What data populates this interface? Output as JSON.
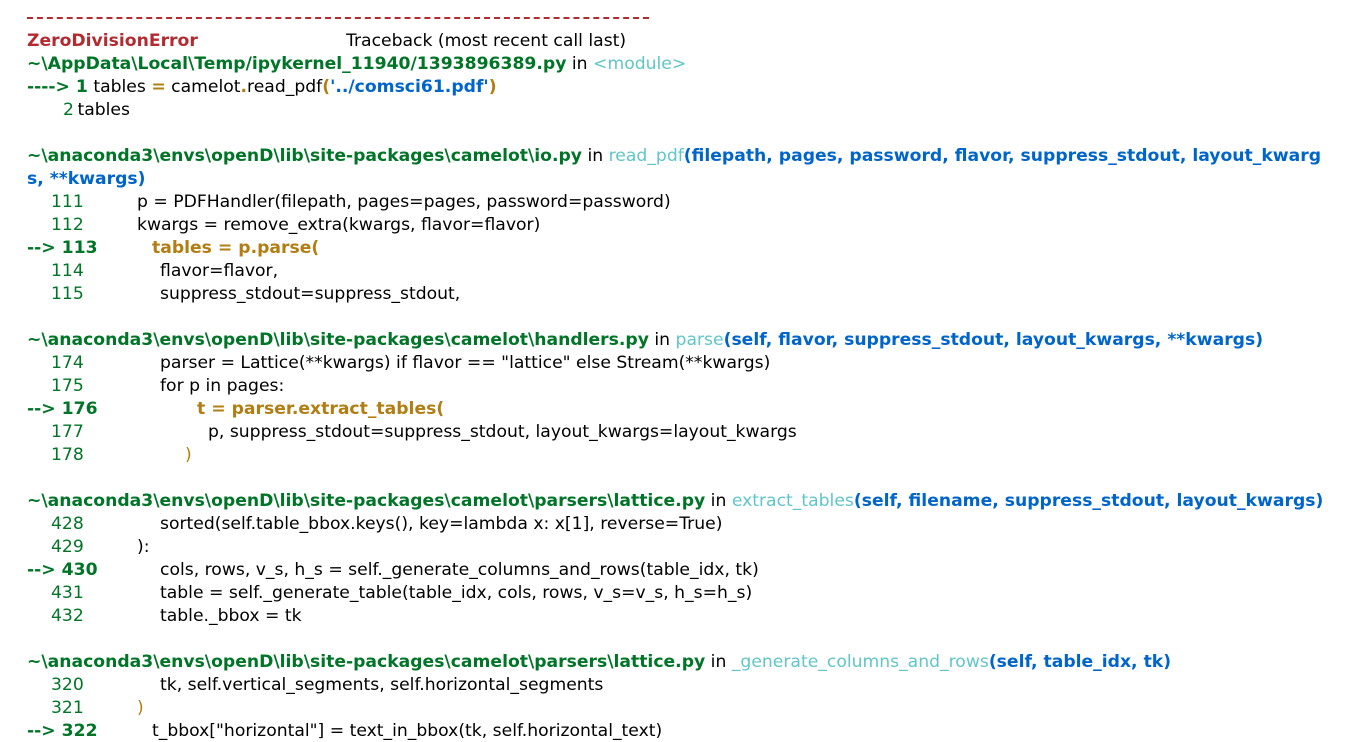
{
  "traceback": {
    "error_type": "ZeroDivisionError",
    "header_text": "Traceback (most recent call last)",
    "frame1": {
      "path": "~\\AppData\\Local\\Temp/ipykernel_11940/1393896389.py",
      "in_text": " in ",
      "func": "<module>",
      "lines": [
        {
          "arrow": "----> ",
          "num": "1",
          "pre": " tables ",
          "eq": "=",
          "call": " camelot",
          "dot": ".",
          "fn": "read_pdf",
          "open": "(",
          "str": "'../comsci61.pdf'",
          "close": ")"
        },
        {
          "num": "2",
          "code": " tables"
        }
      ]
    },
    "frame2": {
      "path": "~\\anaconda3\\envs\\openD\\lib\\site-packages\\camelot\\io.py",
      "in_text": " in ",
      "func": "read_pdf",
      "args_line1": "(filepath, pages, password, flavor, suppress_stdout, layout_kwarg",
      "args_line2": "s, **kwargs)",
      "lines": [
        {
          "num": "111",
          "code": "p = PDFHandler(filepath, pages=pages, password=password)"
        },
        {
          "num": "112",
          "code": "kwargs = remove_extra(kwargs, flavor=flavor)"
        },
        {
          "arrow": "--> ",
          "num": "113",
          "code": "tables = p.parse("
        },
        {
          "num": "114",
          "code": "flavor=flavor,"
        },
        {
          "num": "115",
          "code": "suppress_stdout=suppress_stdout,"
        }
      ]
    },
    "frame3": {
      "path": "~\\anaconda3\\envs\\openD\\lib\\site-packages\\camelot\\handlers.py",
      "in_text": " in ",
      "func": "parse",
      "args": "(self, flavor, suppress_stdout, layout_kwargs, **kwargs)",
      "lines": [
        {
          "num": "174",
          "code": "parser = Lattice(**kwargs) if flavor == \"lattice\" else Stream(**kwargs)"
        },
        {
          "num": "175",
          "code": "for p in pages:"
        },
        {
          "arrow": "--> ",
          "num": "176",
          "code": "t = parser.extract_tables("
        },
        {
          "num": "177",
          "code": "p, suppress_stdout=suppress_stdout, layout_kwargs=layout_kwargs"
        },
        {
          "num": "178",
          "code": ")"
        }
      ]
    },
    "frame4": {
      "path": "~\\anaconda3\\envs\\openD\\lib\\site-packages\\camelot\\parsers\\lattice.py",
      "in_text": " in ",
      "func": "extract_tables",
      "args": "(self, filename, suppress_stdout, layout_kwargs)",
      "lines": [
        {
          "num": "428",
          "code": "sorted(self.table_bbox.keys(), key=lambda x: x[1], reverse=True)"
        },
        {
          "num": "429",
          "code": "):"
        },
        {
          "arrow": "--> ",
          "num": "430",
          "code": "cols, rows, v_s, h_s = self._generate_columns_and_rows(table_idx, tk)"
        },
        {
          "num": "431",
          "code": "table = self._generate_table(table_idx, cols, rows, v_s=v_s, h_s=h_s)"
        },
        {
          "num": "432",
          "code": "table._bbox = tk"
        }
      ]
    },
    "frame5": {
      "path": "~\\anaconda3\\envs\\openD\\lib\\site-packages\\camelot\\parsers\\lattice.py",
      "in_text": " in ",
      "func": "_generate_columns_and_rows",
      "args": "(self, table_idx, tk)",
      "lines": [
        {
          "num": "320",
          "code": "tk, self.vertical_segments, self.horizontal_segments"
        },
        {
          "num": "321",
          "code": ")"
        },
        {
          "arrow": "--> ",
          "num": "322",
          "code": "t_bbox[\"horizontal\"] = text_in_bbox(tk, self.horizontal_text)"
        }
      ]
    }
  }
}
